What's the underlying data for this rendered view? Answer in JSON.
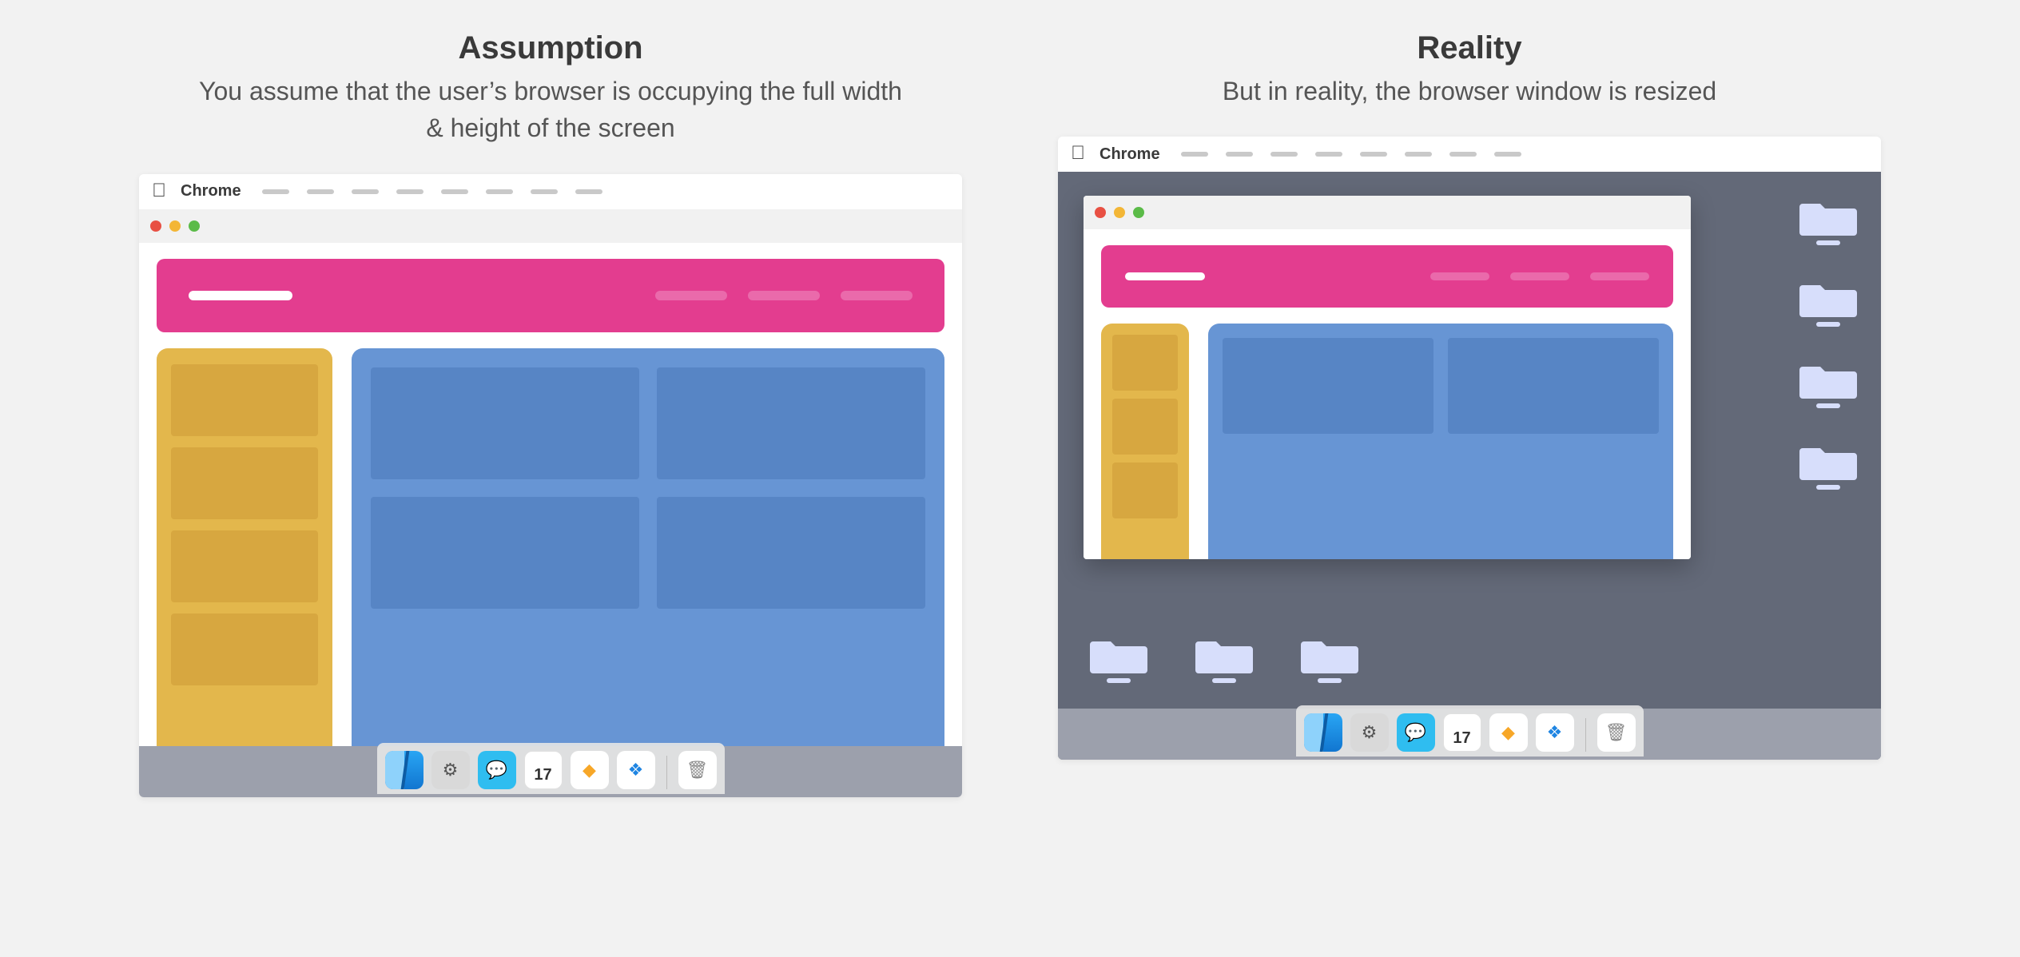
{
  "left": {
    "title": "Assumption",
    "desc": "You assume that the user’s browser is occupying the full width & height of the screen"
  },
  "right": {
    "title": "Reality",
    "desc": "But in reality, the browser window is resized"
  },
  "menubar_app": "Chrome",
  "calendar_day": "17",
  "dock": [
    "finder",
    "settings",
    "messages",
    "calendar",
    "sketch",
    "dropbox",
    "|",
    "trash"
  ]
}
